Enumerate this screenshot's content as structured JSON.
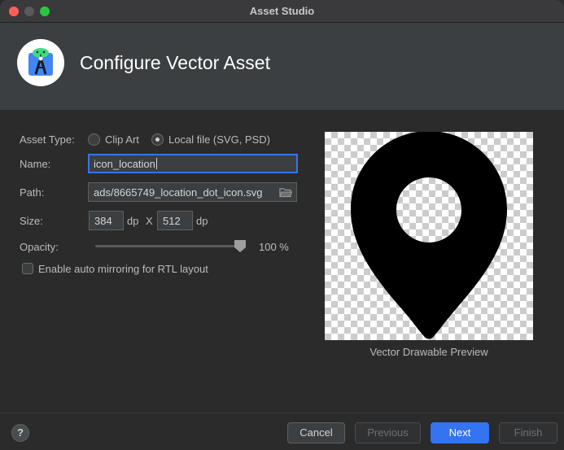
{
  "window": {
    "title": "Asset Studio"
  },
  "header": {
    "title": "Configure Vector Asset",
    "logo_icon": "android-studio-icon"
  },
  "form": {
    "asset_type_label": "Asset Type:",
    "asset_type_options": [
      {
        "label": "Clip Art",
        "selected": false
      },
      {
        "label": "Local file (SVG, PSD)",
        "selected": true
      }
    ],
    "name_label": "Name:",
    "name_value": "icon_location",
    "path_label": "Path:",
    "path_value": "ads/8665749_location_dot_icon.svg",
    "size_label": "Size:",
    "width_value": "384",
    "width_unit": "dp",
    "size_separator": "X",
    "height_value": "512",
    "height_unit": "dp",
    "opacity_label": "Opacity:",
    "opacity_value": "100 %",
    "opacity_level": 1.0,
    "rtl_label": "Enable auto mirroring for RTL layout",
    "rtl_checked": false
  },
  "preview": {
    "caption": "Vector Drawable Preview",
    "icon": "location-pin-icon"
  },
  "footer": {
    "help_label": "?",
    "cancel_label": "Cancel",
    "previous_label": "Previous",
    "next_label": "Next",
    "finish_label": "Finish"
  },
  "colors": {
    "accent": "#3574f0",
    "background": "#2b2b2b",
    "header": "#3c3f41"
  }
}
